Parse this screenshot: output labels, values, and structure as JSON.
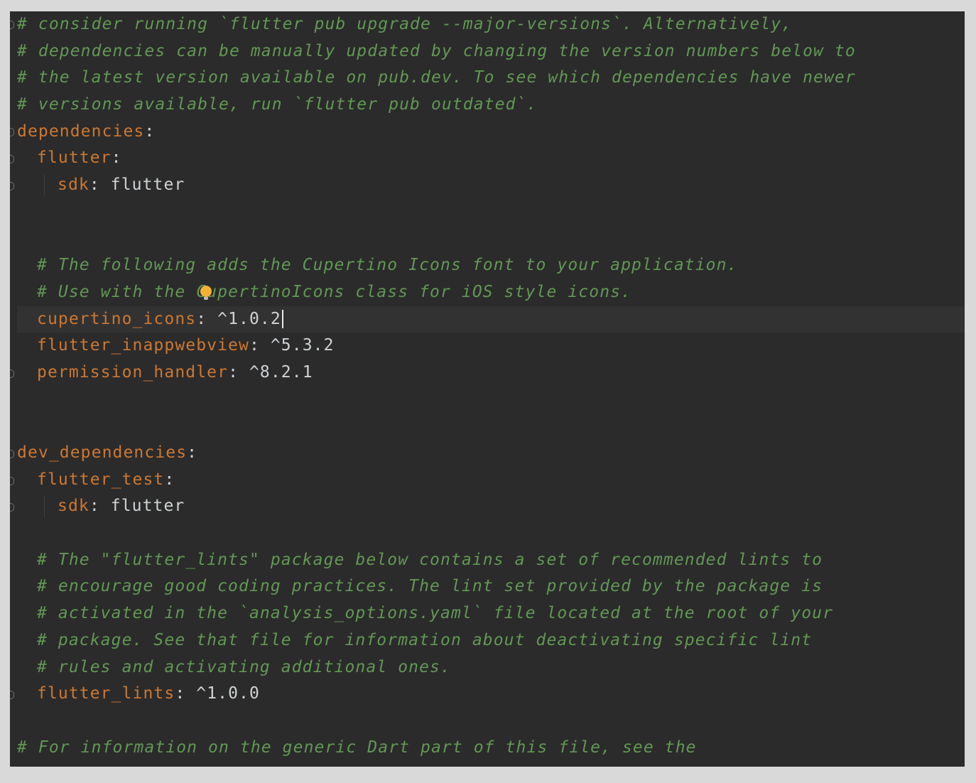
{
  "editor": {
    "file_type": "yaml",
    "lines": [
      {
        "indent": 0,
        "kind": "comment",
        "text": "# consider running `flutter pub upgrade --major-versions`. Alternatively,"
      },
      {
        "indent": 0,
        "kind": "comment",
        "text": "# dependencies can be manually updated by changing the version numbers below to"
      },
      {
        "indent": 0,
        "kind": "comment",
        "text": "# the latest version available on pub.dev. To see which dependencies have newer"
      },
      {
        "indent": 0,
        "kind": "comment",
        "text": "# versions available, run `flutter pub outdated`."
      },
      {
        "indent": 0,
        "kind": "pair",
        "key": "dependencies",
        "value": ""
      },
      {
        "indent": 1,
        "kind": "pair",
        "key": "flutter",
        "value": ""
      },
      {
        "indent": 2,
        "kind": "pair",
        "key": "sdk",
        "value": "flutter"
      },
      {
        "indent": 0,
        "kind": "blank"
      },
      {
        "indent": 0,
        "kind": "blank"
      },
      {
        "indent": 1,
        "kind": "comment",
        "text": "# The following adds the Cupertino Icons font to your application."
      },
      {
        "indent": 1,
        "kind": "comment",
        "text": "# Use with the CupertinoIcons class for iOS style icons."
      },
      {
        "indent": 1,
        "kind": "pair",
        "key": "cupertino_icons",
        "value": "^1.0.2"
      },
      {
        "indent": 1,
        "kind": "pair",
        "key": "flutter_inappwebview",
        "value": "^5.3.2"
      },
      {
        "indent": 1,
        "kind": "pair",
        "key": "permission_handler",
        "value": "^8.2.1"
      },
      {
        "indent": 0,
        "kind": "blank"
      },
      {
        "indent": 0,
        "kind": "blank"
      },
      {
        "indent": 0,
        "kind": "pair",
        "key": "dev_dependencies",
        "value": ""
      },
      {
        "indent": 1,
        "kind": "pair",
        "key": "flutter_test",
        "value": ""
      },
      {
        "indent": 2,
        "kind": "pair",
        "key": "sdk",
        "value": "flutter"
      },
      {
        "indent": 0,
        "kind": "blank"
      },
      {
        "indent": 1,
        "kind": "comment",
        "text": "# The \"flutter_lints\" package below contains a set of recommended lints to"
      },
      {
        "indent": 1,
        "kind": "comment",
        "text": "# encourage good coding practices. The lint set provided by the package is"
      },
      {
        "indent": 1,
        "kind": "comment",
        "text": "# activated in the `analysis_options.yaml` file located at the root of your"
      },
      {
        "indent": 1,
        "kind": "comment",
        "text": "# package. See that file for information about deactivating specific lint"
      },
      {
        "indent": 1,
        "kind": "comment",
        "text": "# rules and activating additional ones."
      },
      {
        "indent": 1,
        "kind": "pair",
        "key": "flutter_lints",
        "value": "^1.0.0"
      },
      {
        "indent": 0,
        "kind": "blank"
      },
      {
        "indent": 0,
        "kind": "comment",
        "text": "# For information on the generic Dart part of this file, see the"
      }
    ]
  },
  "colors": {
    "background": "#2b2b2b",
    "comment": "#629755",
    "key": "#cc7832",
    "value": "#d0d3d6",
    "current_line": "#323232",
    "bulb": "#f2b233"
  },
  "icons": {
    "intention_action": "lightbulb-icon",
    "fold_marker": "fold-marker-icon"
  }
}
